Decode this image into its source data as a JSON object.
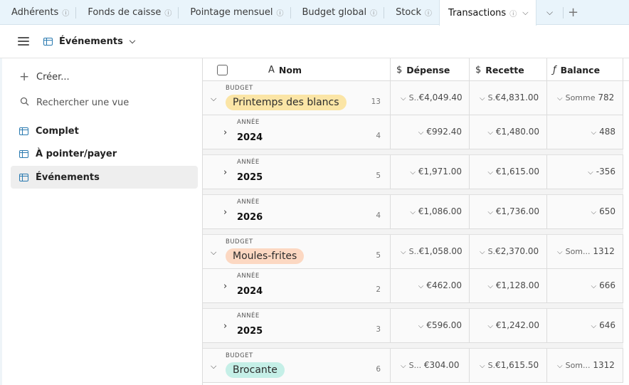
{
  "tabs": [
    {
      "label": "Adhérents",
      "info_icon": "info-icon"
    },
    {
      "label": "Fonds de caisse",
      "info_icon": "info-icon"
    },
    {
      "label": "Pointage mensuel",
      "info_icon": "info-icon"
    },
    {
      "label": "Budget global",
      "info_icon": "info-icon"
    },
    {
      "label": "Stock",
      "info_icon": "info-icon"
    },
    {
      "label": "Transactions",
      "info_icon": "info-icon",
      "active": true
    }
  ],
  "tab_controls": {
    "overflow_icon": "chevron-down-icon",
    "add_icon": "plus-icon"
  },
  "view_header": {
    "menu_icon": "hamburger-icon",
    "view_icon": "grid-icon",
    "view_name": "Événements",
    "dropdown_icon": "chevron-down-icon"
  },
  "sidebar": {
    "create_label": "Créer...",
    "search_placeholder": "Rechercher une vue",
    "views": [
      {
        "label": "Complet",
        "selected": false
      },
      {
        "label": "À pointer/payer",
        "selected": false
      },
      {
        "label": "Événements",
        "selected": true
      }
    ]
  },
  "table": {
    "columns": {
      "name": {
        "label": "Nom",
        "icon": "text-icon"
      },
      "depense": {
        "label": "Dépense",
        "icon": "dollar-icon"
      },
      "recette": {
        "label": "Recette",
        "icon": "dollar-icon"
      },
      "balance": {
        "label": "Balance",
        "icon": "formula-icon"
      }
    },
    "group_label": "BUDGET",
    "subgroup_label": "ANNÉE",
    "rows": [
      {
        "kind": "group",
        "name": "Printemps des blancs",
        "color": "#fbe5a6",
        "count": "13",
        "dep_prefix": "S..",
        "dep": "€4,049.40",
        "rec_prefix": "S.",
        "rec": "€4,831.00",
        "bal_prefix": "Somme",
        "bal": "782"
      },
      {
        "kind": "sub",
        "name": "2024",
        "count": "4",
        "dep": "€992.40",
        "rec": "€1,480.00",
        "bal": "488"
      },
      {
        "kind": "sub",
        "name": "2025",
        "count": "5",
        "dep": "€1,971.00",
        "rec": "€1,615.00",
        "bal": "-356"
      },
      {
        "kind": "sub",
        "name": "2026",
        "count": "4",
        "dep": "€1,086.00",
        "rec": "€1,736.00",
        "bal": "650"
      },
      {
        "kind": "group",
        "name": "Moules-frites",
        "color": "#fcd8c2",
        "count": "5",
        "dep_prefix": "S..",
        "dep": "€1,058.00",
        "rec_prefix": "S.",
        "rec": "€2,370.00",
        "bal_prefix": "Som...",
        "bal": "1312"
      },
      {
        "kind": "sub",
        "name": "2024",
        "count": "2",
        "dep": "€462.00",
        "rec": "€1,128.00",
        "bal": "666"
      },
      {
        "kind": "sub",
        "name": "2025",
        "count": "3",
        "dep": "€596.00",
        "rec": "€1,242.00",
        "bal": "646"
      },
      {
        "kind": "group",
        "name": "Brocante",
        "color": "#c5efe7",
        "count": "6",
        "dep_prefix": "S...",
        "dep": "€304.00",
        "rec_prefix": "S.",
        "rec": "€1,615.50",
        "bal_prefix": "Som...",
        "bal": "1312"
      }
    ]
  }
}
